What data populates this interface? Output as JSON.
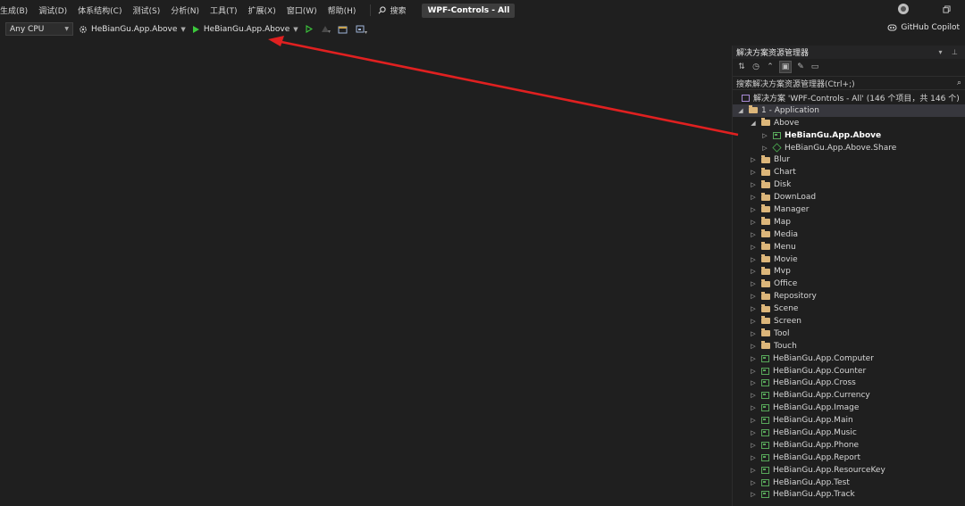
{
  "menu": {
    "items": [
      "生成(B)",
      "调试(D)",
      "体系结构(C)",
      "测试(S)",
      "分析(N)",
      "工具(T)",
      "扩展(X)",
      "窗口(W)",
      "帮助(H)"
    ],
    "search_label": "搜索",
    "title": "WPF-Controls - All"
  },
  "toolbar": {
    "platform": "Any CPU",
    "startup_project": "HeBianGu.App.Above",
    "run_target": "HeBianGu.App.Above",
    "copilot_label": "GitHub Copilot"
  },
  "explorer": {
    "title": "解决方案资源管理器",
    "search_placeholder": "搜索解决方案资源管理器(Ctrl+;)",
    "solution_label": "解决方案 'WPF-Controls - All' (146 个项目，共 146 个)",
    "application_folder": "1 - Application",
    "above_folder": "Above",
    "above_children": [
      "HeBianGu.App.Above",
      "HeBianGu.App.Above.Share"
    ],
    "folders": [
      "Blur",
      "Chart",
      "Disk",
      "DownLoad",
      "Manager",
      "Map",
      "Media",
      "Menu",
      "Movie",
      "Mvp",
      "Office",
      "Repository",
      "Scene",
      "Screen",
      "Tool",
      "Touch"
    ],
    "projects": [
      "HeBianGu.App.Computer",
      "HeBianGu.App.Counter",
      "HeBianGu.App.Cross",
      "HeBianGu.App.Currency",
      "HeBianGu.App.Image",
      "HeBianGu.App.Main",
      "HeBianGu.App.Music",
      "HeBianGu.App.Phone",
      "HeBianGu.App.Report",
      "HeBianGu.App.ResourceKey",
      "HeBianGu.App.Test",
      "HeBianGu.App.Track"
    ]
  },
  "colors": {
    "accent_arrow": "#e02020",
    "run_green": "#3cc83c",
    "folder": "#dcb67a"
  }
}
